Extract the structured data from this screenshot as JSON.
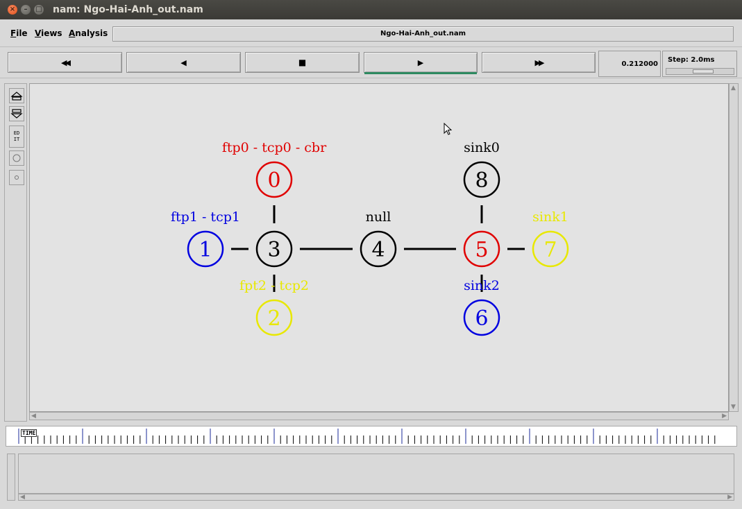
{
  "window": {
    "title": "nam: Ngo-Hai-Anh_out.nam"
  },
  "menu": {
    "items": [
      "File",
      "Views",
      "Analysis"
    ],
    "filename": "Ngo-Hai-Anh_out.nam"
  },
  "toolbar": {
    "buttons": [
      {
        "name": "rewind",
        "glyph": "◀◀"
      },
      {
        "name": "step-back",
        "glyph": "◀"
      },
      {
        "name": "stop",
        "glyph": "■"
      },
      {
        "name": "play",
        "glyph": "▶"
      },
      {
        "name": "fast-forward",
        "glyph": "▶▶"
      }
    ],
    "active_button": "play",
    "time": "0.212000",
    "step_label": "Step: 2.0ms"
  },
  "left_tools": {
    "edit_label": "EDIT"
  },
  "network": {
    "nodes": [
      {
        "id": "0",
        "color": "#e00000",
        "label": "ftp0 - tcp0 - cbr",
        "label_color": "#e00000"
      },
      {
        "id": "1",
        "color": "#0000e0",
        "label": "ftp1 - tcp1",
        "label_color": "#0000e0"
      },
      {
        "id": "2",
        "color": "#e8e800",
        "label": "fpt2 - tcp2",
        "label_color": "#e8e800"
      },
      {
        "id": "3",
        "color": "#000000",
        "label": "",
        "label_color": "#000000"
      },
      {
        "id": "4",
        "color": "#000000",
        "label": "null",
        "label_color": "#000000"
      },
      {
        "id": "5",
        "color": "#e00000",
        "label": "",
        "label_color": "#000000"
      },
      {
        "id": "6",
        "color": "#0000e0",
        "label": "sink2",
        "label_color": "#0000e0"
      },
      {
        "id": "7",
        "color": "#e8e800",
        "label": "sink1",
        "label_color": "#e8e800"
      },
      {
        "id": "8",
        "color": "#000000",
        "label": "sink0",
        "label_color": "#000000"
      }
    ],
    "links": [
      [
        "0",
        "3"
      ],
      [
        "1",
        "3"
      ],
      [
        "2",
        "3"
      ],
      [
        "3",
        "4"
      ],
      [
        "4",
        "5"
      ],
      [
        "5",
        "8"
      ],
      [
        "5",
        "7"
      ],
      [
        "5",
        "6"
      ]
    ]
  },
  "timeline": {
    "label": "TIME"
  }
}
